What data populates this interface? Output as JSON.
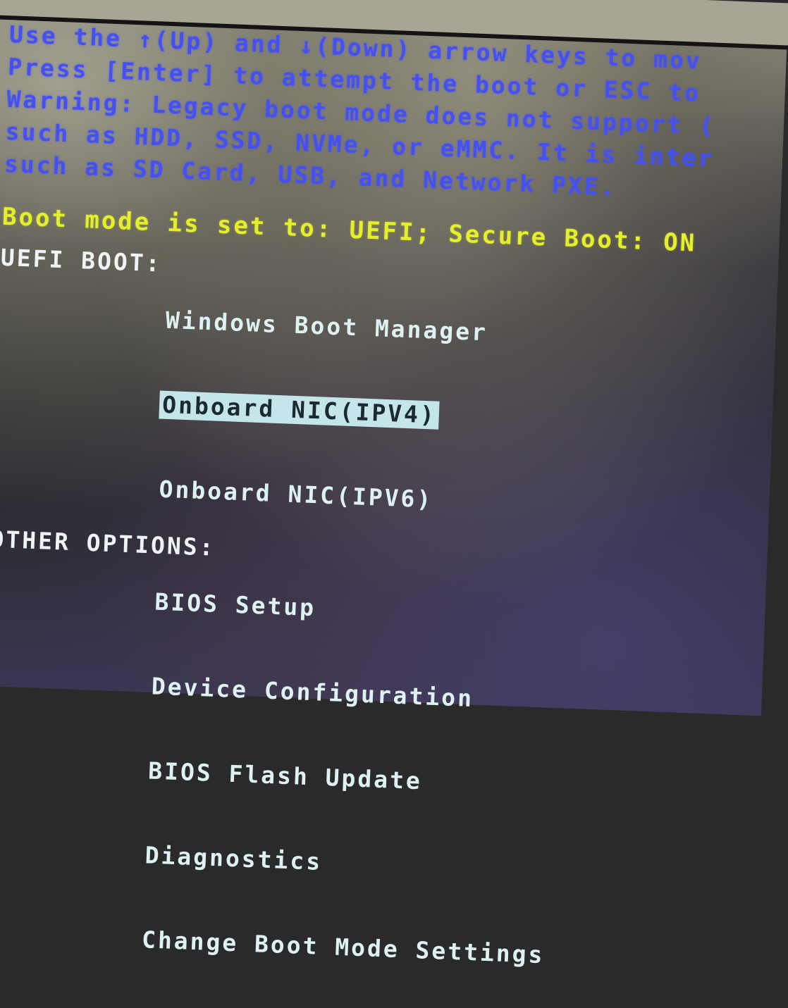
{
  "screen": {
    "type": "Boot menu (one-time boot)",
    "colors": {
      "info_text": "#4550f0",
      "status_text": "#e6f02a",
      "menu_text": "#dff2f3",
      "highlight_bg": "#c4e6ea",
      "highlight_text": "#1a2a30"
    }
  },
  "instructions": [
    "Use the ↑(Up) and ↓(Down) arrow keys to mov",
    "Press [Enter] to attempt the boot or ESC to",
    "Warning: Legacy boot mode does not support (",
    "such as HDD, SSD, NVMe, or eMMC. It is inter",
    "such as SD Card, USB, and Network PXE."
  ],
  "status": "Boot mode is set to: UEFI; Secure Boot: ON",
  "sections": [
    {
      "heading": "UEFI BOOT:",
      "items": [
        {
          "label": "Windows Boot Manager",
          "selected": false
        },
        {
          "label": "Onboard NIC(IPV4)",
          "selected": true
        },
        {
          "label": "Onboard NIC(IPV6)",
          "selected": false
        }
      ]
    },
    {
      "heading": "OTHER OPTIONS:",
      "items": [
        {
          "label": "BIOS Setup",
          "selected": false
        },
        {
          "label": "Device Configuration",
          "selected": false
        },
        {
          "label": "BIOS Flash Update",
          "selected": false
        },
        {
          "label": "Diagnostics",
          "selected": false
        },
        {
          "label": "Change Boot Mode Settings",
          "selected": false
        }
      ]
    }
  ]
}
